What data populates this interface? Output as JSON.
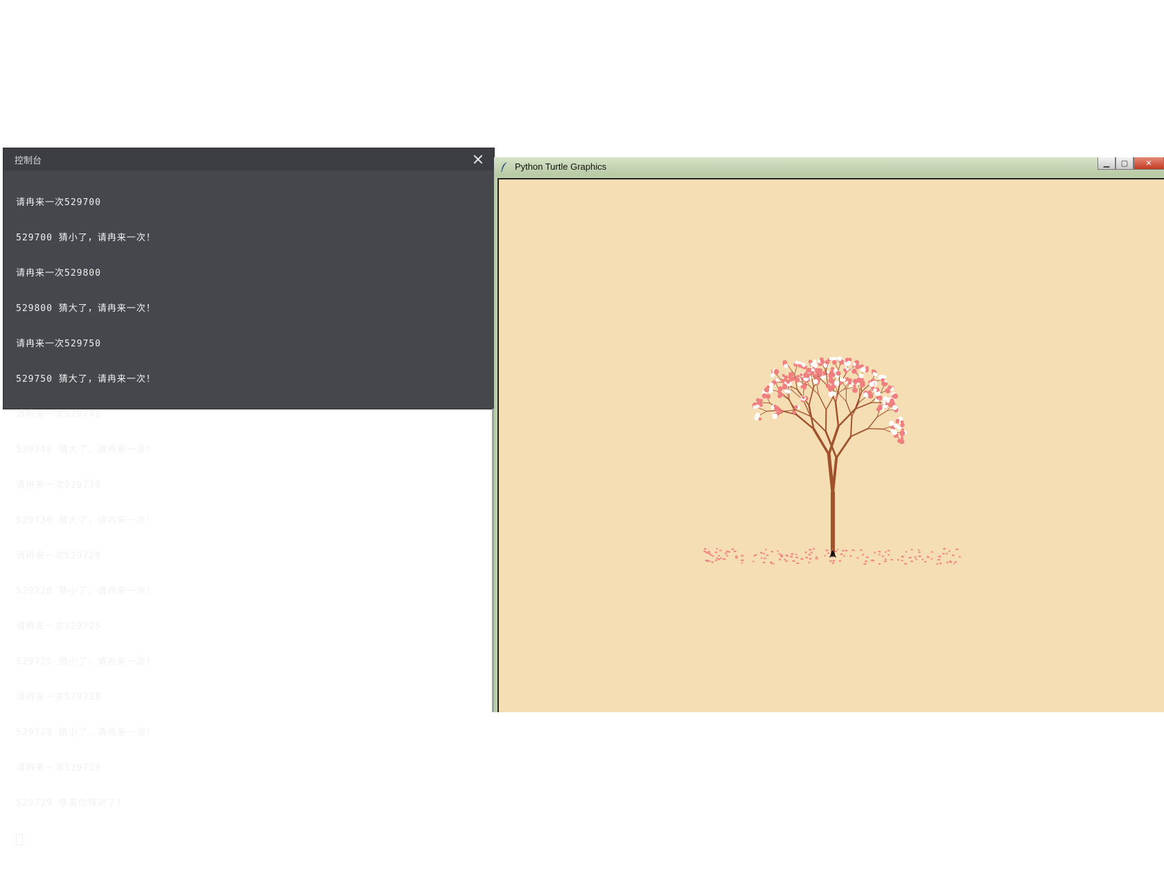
{
  "console": {
    "title": "控制台",
    "lines": [
      "请冉来一次529700",
      "529700 猜小了，请冉来一次！",
      "请冉来一次529800",
      "529800 猜大了，请冉来一次！",
      "请冉来一次529750",
      "529750 猜大了，请冉来一次！",
      "请冉来一次529740",
      "529740 猜大了，请冉来一次！",
      "请冉来一次529730",
      "529730 猜大了，请冉来一次！",
      "请冉来一次529720",
      "529720 猜小了，请冉来一次！",
      "请冉来一次529725",
      "529725 猜小了，请冉来一次！",
      "请冉来一次529728",
      "529728 猜小了，请冉来一次！",
      "请冉来一次529729",
      "529729 恭喜你猜对了！"
    ],
    "close_icon": "close-icon"
  },
  "turtle_window": {
    "title": "Python Turtle Graphics",
    "icon": "feather-icon",
    "controls": {
      "minimize": "minimize-icon",
      "maximize": "maximize-icon",
      "close": "close-icon"
    },
    "canvas_color": "#f5deb3",
    "trunk_color": "#a0522d",
    "blossom_color": "#f08080"
  }
}
